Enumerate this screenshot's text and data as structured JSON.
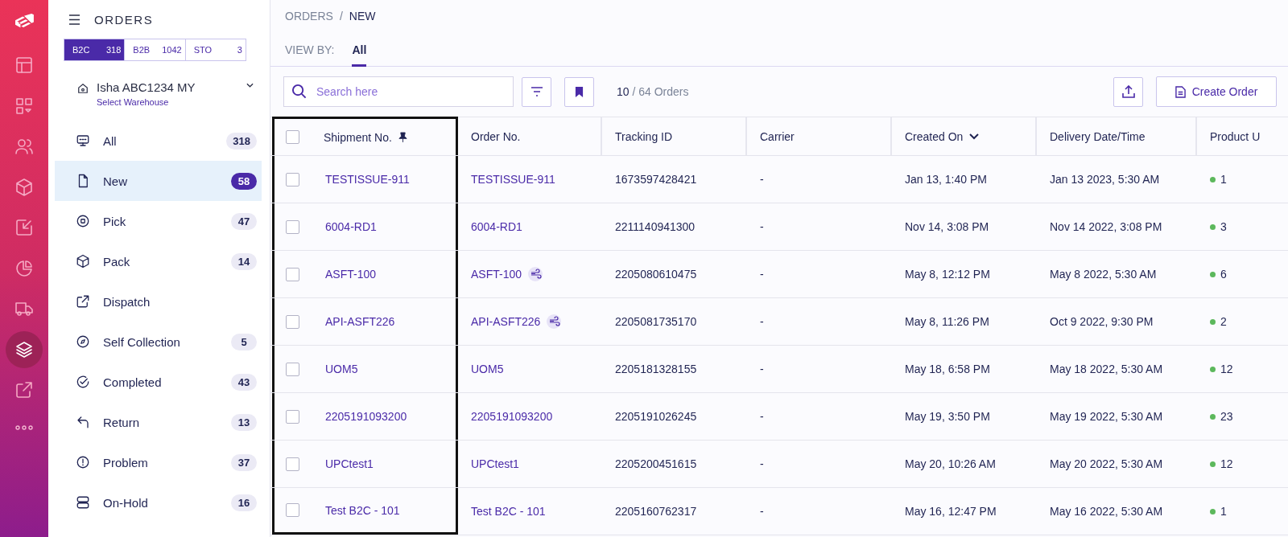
{
  "rail": [
    {
      "selected": false
    },
    {
      "selected": false
    },
    {
      "selected": false
    },
    {
      "selected": false
    },
    {
      "selected": false
    },
    {
      "selected": false
    },
    {
      "selected": false
    },
    {
      "selected": true
    },
    {
      "selected": false
    }
  ],
  "panel": {
    "title": "ORDERS",
    "segments": [
      {
        "label": "B2C",
        "count": "318",
        "selected": true
      },
      {
        "label": "B2B",
        "count": "1042",
        "selected": false
      },
      {
        "label": "STO",
        "count": "3",
        "selected": false
      }
    ],
    "warehouse": {
      "name": "Isha ABC1234 MY",
      "action": "Select Warehouse"
    },
    "nav": [
      {
        "label": "All",
        "count": "318",
        "selected": false
      },
      {
        "label": "New",
        "count": "58",
        "selected": true
      },
      {
        "label": "Pick",
        "count": "47",
        "selected": false
      },
      {
        "label": "Pack",
        "count": "14",
        "selected": false
      },
      {
        "label": "Dispatch",
        "selected": false
      },
      {
        "label": "Self Collection",
        "count": "5",
        "selected": false
      },
      {
        "label": "Completed",
        "count": "43",
        "selected": false
      },
      {
        "label": "Return",
        "count": "13",
        "selected": false
      },
      {
        "label": "Problem",
        "count": "37",
        "selected": false
      },
      {
        "label": "On-Hold",
        "count": "16",
        "selected": false
      }
    ]
  },
  "breadcrumb": {
    "parent": "ORDERS",
    "separator": "/",
    "current": "NEW"
  },
  "view_by": {
    "label": "VIEW BY:",
    "tabs": [
      {
        "label": "All",
        "selected": true
      }
    ]
  },
  "toolbar": {
    "search_placeholder": "Search here",
    "shown": "10",
    "total": "/ 64 Orders",
    "create_button": "Create Order"
  },
  "table": {
    "select_all_checked": false,
    "columns": [
      {
        "label": "Shipment No.",
        "pinned": true
      },
      {
        "label": "Order No.",
        "pinned": false
      },
      {
        "label": "Tracking ID",
        "pinned": false
      },
      {
        "label": "Carrier",
        "pinned": false
      },
      {
        "label": "Created On",
        "pinned": false,
        "sorted": true
      },
      {
        "label": "Delivery Date/Time",
        "pinned": false
      },
      {
        "label": "Product U",
        "pinned": false
      }
    ],
    "rows": [
      {
        "checked": false,
        "shipment": "TESTISSUE-911",
        "order": "TESTISSUE-911",
        "express": false,
        "tracking": "1673597428421",
        "carrier": "-",
        "created": "Jan 13, 1:40 PM",
        "delivery": "Jan 13 2023, 5:30 AM",
        "products": "1",
        "color": "#5cb85c"
      },
      {
        "checked": false,
        "shipment": "6004-RD1",
        "order": "6004-RD1",
        "express": false,
        "tracking": "2211140941300",
        "carrier": "-",
        "created": "Nov 14, 3:08 PM",
        "delivery": "Nov 14 2022, 3:08 PM",
        "products": "3",
        "color": "#5cb85c"
      },
      {
        "checked": false,
        "shipment": "ASFT-100",
        "order": "ASFT-100",
        "express": true,
        "tracking": "2205080610475",
        "carrier": "-",
        "created": "May 8, 12:12 PM",
        "delivery": "May 8 2022, 5:30 AM",
        "products": "6",
        "color": "#5cb85c"
      },
      {
        "checked": false,
        "shipment": "API-ASFT226",
        "order": "API-ASFT226",
        "express": true,
        "tracking": "2205081735170",
        "carrier": "-",
        "created": "May 8, 11:26 PM",
        "delivery": "Oct 9 2022, 9:30 PM",
        "products": "2",
        "color": "#5cb85c"
      },
      {
        "checked": false,
        "shipment": "UOM5",
        "order": "UOM5",
        "express": false,
        "tracking": "2205181328155",
        "carrier": "-",
        "created": "May 18, 6:58 PM",
        "delivery": "May 18 2022, 5:30 AM",
        "products": "12",
        "color": "#5cb85c"
      },
      {
        "checked": false,
        "shipment": "2205191093200",
        "order": "2205191093200",
        "express": false,
        "tracking": "2205191026245",
        "carrier": "-",
        "created": "May 19, 3:50 PM",
        "delivery": "May 19 2022, 5:30 AM",
        "products": "23",
        "color": "#5cb85c"
      },
      {
        "checked": false,
        "shipment": "UPCtest1",
        "order": "UPCtest1",
        "express": false,
        "tracking": "2205200451615",
        "carrier": "-",
        "created": "May 20, 10:26 AM",
        "delivery": "May 20 2022, 5:30 AM",
        "products": "12",
        "color": "#5cb85c"
      },
      {
        "checked": false,
        "shipment": "Test B2C - 101",
        "order": "Test B2C - 101",
        "express": false,
        "tracking": "2205160762317",
        "carrier": "-",
        "created": "May 16, 12:47 PM",
        "delivery": "May 16 2022, 5:30 AM",
        "products": "1",
        "color": "#5cb85c"
      }
    ]
  }
}
